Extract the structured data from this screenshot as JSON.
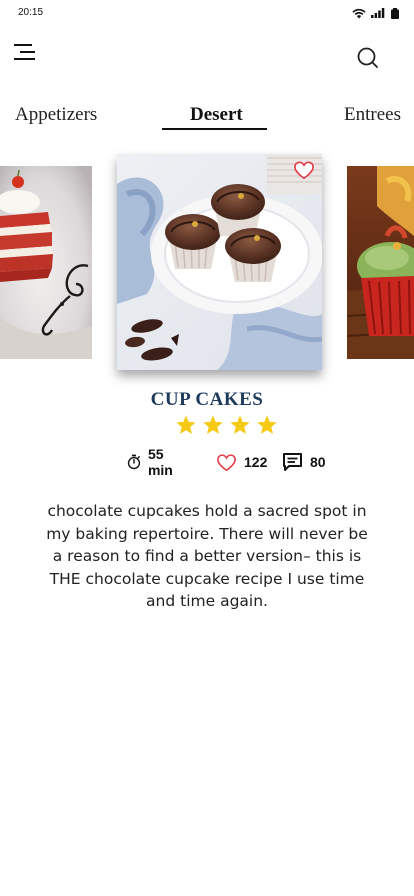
{
  "status_bar": {
    "time": "20:15"
  },
  "tabs": [
    {
      "label": "Appetizers",
      "active": false
    },
    {
      "label": "Desert",
      "active": true
    },
    {
      "label": "Entrees",
      "active": false
    }
  ],
  "recipe": {
    "title": "CUP CAKES",
    "rating": 4,
    "rating_max": 4,
    "cook_time": "55 min",
    "likes": "122",
    "comments": "80",
    "description": "chocolate cupcakes hold a sacred spot in my baking repertoire. There will never be a reason to find a better version– this is THE chocolate cupcake recipe I use time and time again."
  },
  "colors": {
    "title": "#1e3a5c",
    "star": "#f6c915",
    "heart": "#e23b47",
    "underline": "#111111"
  },
  "icons": {
    "menu": "hamburger-menu-icon",
    "search": "search-icon",
    "favorite": "heart-outline-icon",
    "timer": "stopwatch-icon",
    "likes": "heart-outline-icon",
    "comments": "comment-icon"
  }
}
